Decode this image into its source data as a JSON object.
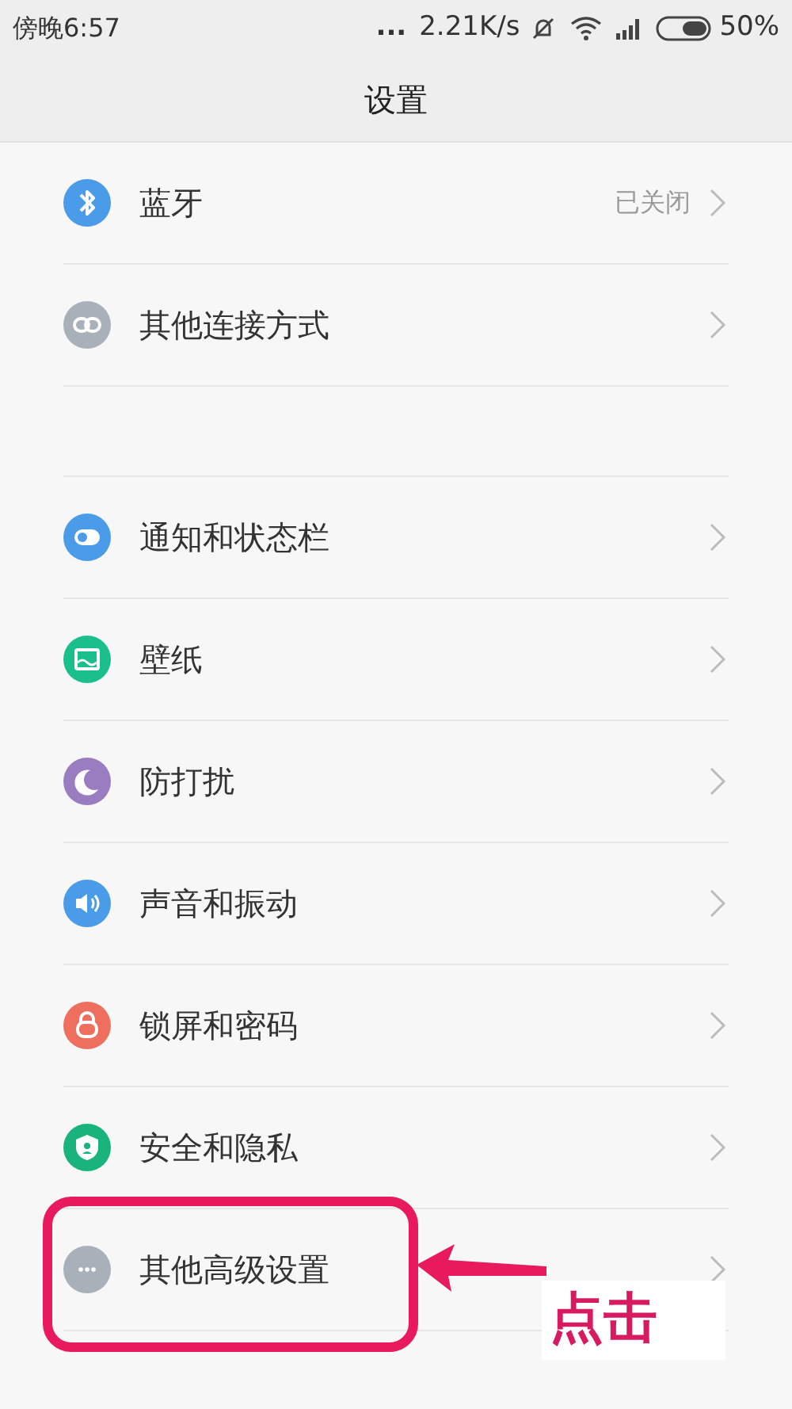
{
  "status_bar": {
    "time": "傍晚6:57",
    "more": "...",
    "speed": "2.21K/s",
    "battery": "50%"
  },
  "title": "设置",
  "groups": [
    {
      "items": [
        {
          "kind": "bluetooth",
          "color": "#4a9be8",
          "label": "蓝牙",
          "value": "已关闭"
        },
        {
          "kind": "link",
          "color": "#a8b0ba",
          "label": "其他连接方式"
        }
      ]
    },
    {
      "items": [
        {
          "kind": "toggle",
          "color": "#4a9be8",
          "label": "通知和状态栏"
        },
        {
          "kind": "wallpaper",
          "color": "#1bbf8c",
          "label": "壁纸"
        },
        {
          "kind": "moon",
          "color": "#9a7cc0",
          "label": "防打扰"
        },
        {
          "kind": "speaker",
          "color": "#4a9be8",
          "label": "声音和振动"
        },
        {
          "kind": "lock",
          "color": "#ef6f5e",
          "label": "锁屏和密码"
        },
        {
          "kind": "shield",
          "color": "#1bb37c",
          "label": "安全和隐私"
        },
        {
          "kind": "dots",
          "color": "#a8b0ba",
          "label": "其他高级设置"
        }
      ]
    }
  ],
  "annotation": {
    "label": "点击"
  }
}
